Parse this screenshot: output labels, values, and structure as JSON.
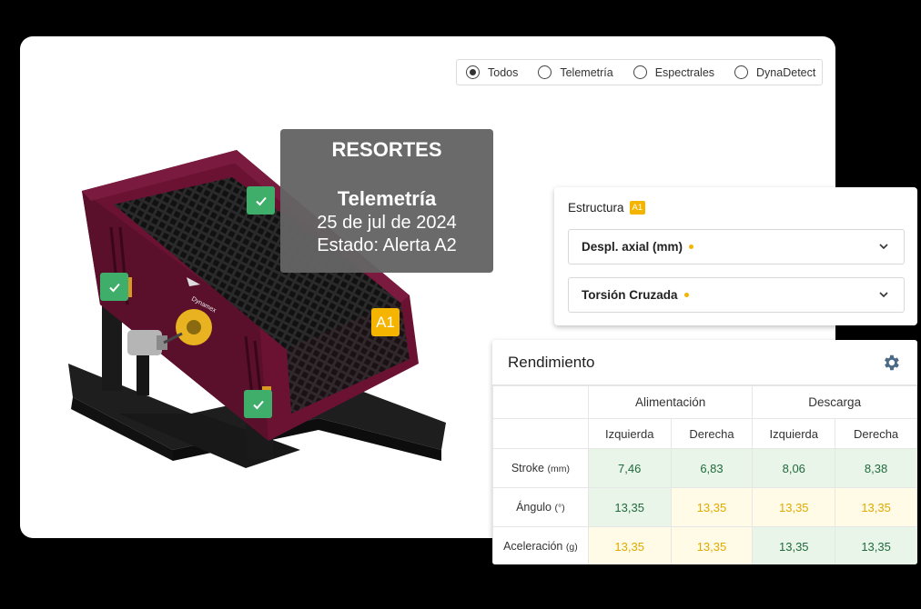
{
  "radio_filter": {
    "options": [
      {
        "label": "Todos",
        "checked": true
      },
      {
        "label": "Telemetría",
        "checked": false
      },
      {
        "label": "Espectrales",
        "checked": false
      },
      {
        "label": "DynaDetect",
        "checked": false
      }
    ]
  },
  "tooltip": {
    "title": "RESORTES",
    "subtitle": "Telemetría",
    "date": "25 de jul de 2024",
    "status": "Estado: Alerta A2"
  },
  "machine": {
    "brand": "Dynamex",
    "markers": {
      "alert_label": "A1"
    }
  },
  "estructura": {
    "title": "Estructura",
    "badge": "A1",
    "selects": [
      {
        "label": "Despl. axial (mm)"
      },
      {
        "label": "Torsión Cruzada"
      }
    ]
  },
  "rendimiento": {
    "title": "Rendimiento",
    "groups": [
      "Alimentación",
      "Descarga"
    ],
    "subheaders": [
      "Izquierda",
      "Derecha",
      "Izquierda",
      "Derecha"
    ],
    "rows": [
      {
        "label": "Stroke",
        "unit": "(mm)",
        "values": [
          "7,46",
          "6,83",
          "8,06",
          "8,38"
        ],
        "status": [
          "ok",
          "ok",
          "ok",
          "ok"
        ]
      },
      {
        "label": "Ángulo",
        "unit": "(°)",
        "values": [
          "13,35",
          "13,35",
          "13,35",
          "13,35"
        ],
        "status": [
          "ok",
          "warn",
          "warn",
          "warn"
        ]
      },
      {
        "label": "Aceleración",
        "unit": "(g)",
        "values": [
          "13,35",
          "13,35",
          "13,35",
          "13,35"
        ],
        "status": [
          "warn",
          "warn",
          "ok",
          "ok"
        ]
      }
    ]
  },
  "colors": {
    "ok": "#3fae6a",
    "alert": "#f5b400",
    "machine": "#6b1233"
  }
}
